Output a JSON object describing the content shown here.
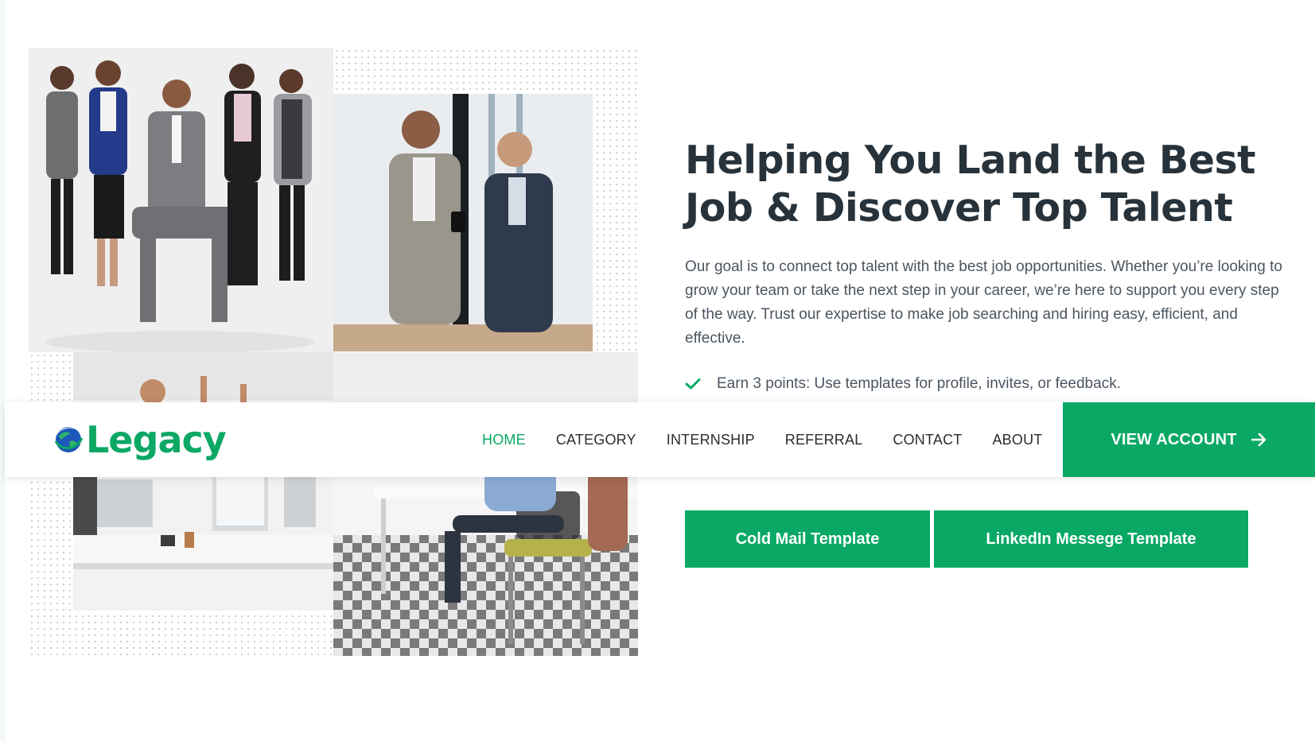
{
  "brand": {
    "name": "Legacy",
    "color": "#0ca864",
    "logo_icon": "globe-icon"
  },
  "nav": {
    "items": [
      {
        "label": "HOME",
        "active": true
      },
      {
        "label": "CATEGORY"
      },
      {
        "label": "INTERNSHIP"
      },
      {
        "label": "REFERRAL"
      },
      {
        "label": "CONTACT"
      },
      {
        "label": "ABOUT"
      }
    ],
    "cta_label": "VIEW ACCOUNT",
    "cta_icon": "arrow-right-icon"
  },
  "hero": {
    "heading": "Helping You Land the Best Job & Discover Top Talent",
    "paragraph": "Our goal is to connect top talent with the best job opportunities. Whether you’re looking to grow your team or take the next step in your career, we’re here to support you every step of the way. Trust our expertise to make job searching and hiring easy, efficient, and effective.",
    "check_item": "Earn 3 points: Use templates for profile, invites, or feedback.",
    "check_icon": "checkmark-icon"
  },
  "buttons": {
    "cold_mail": "Cold Mail Template",
    "linkedin": "LinkedIn Messege Template"
  },
  "colors": {
    "accent": "#0aa865",
    "heading": "#27323a",
    "body_text": "#4b5560"
  }
}
